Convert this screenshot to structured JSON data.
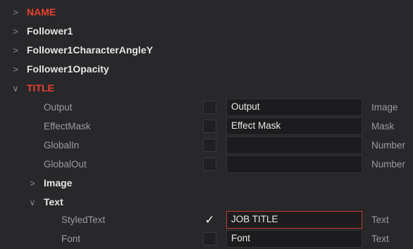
{
  "tree": {
    "collapsed_icon": ">",
    "expanded_icon": "∨",
    "top_items": [
      {
        "label": "NAME",
        "accent": "#e8402f"
      },
      {
        "label": "Follower1"
      },
      {
        "label": "Follower1CharacterAngleY"
      },
      {
        "label": "Follower1Opacity"
      },
      {
        "label": "TITLE",
        "accent": "#e8402f"
      }
    ],
    "title_inputs": [
      {
        "name": "Output",
        "value": "Output",
        "type": "Image",
        "checked": false
      },
      {
        "name": "EffectMask",
        "value": "Effect Mask",
        "type": "Mask",
        "checked": false
      },
      {
        "name": "GlobalIn",
        "value": "",
        "type": "Number",
        "checked": false
      },
      {
        "name": "GlobalOut",
        "value": "",
        "type": "Number",
        "checked": false
      }
    ],
    "groups": [
      {
        "label": "Image",
        "expanded": false
      },
      {
        "label": "Text",
        "expanded": true
      }
    ],
    "text_inputs": [
      {
        "name": "StyledText",
        "value": "JOB TITLE",
        "type": "Text",
        "checked": true,
        "checkmark": "✓"
      },
      {
        "name": "Font",
        "value": "Font",
        "type": "Text",
        "checked": false
      }
    ]
  },
  "colors": {
    "background": "#28282b",
    "accent_red": "#e8402f",
    "active_field_border": "#c03a2b"
  }
}
